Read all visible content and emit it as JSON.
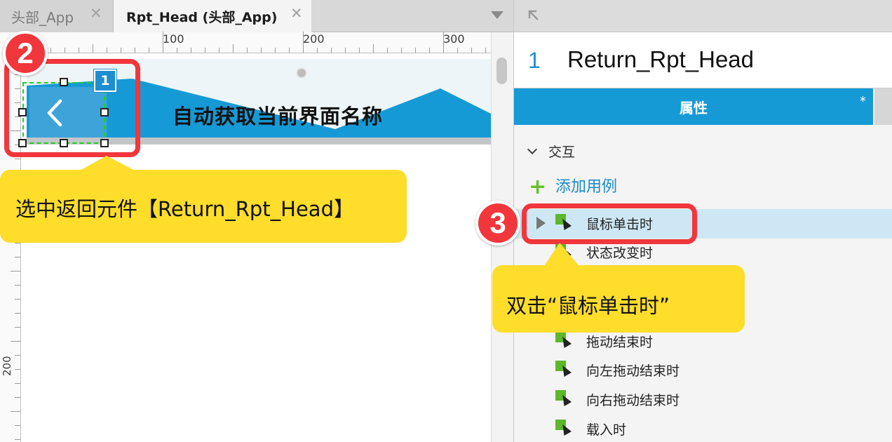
{
  "tabs": [
    {
      "label": "头部_App",
      "close": "✕",
      "active": false
    },
    {
      "label": "Rpt_Head (头部_App)",
      "close": "✕",
      "active": true
    }
  ],
  "ruler": {
    "h_labels": [
      "100",
      "200",
      "300"
    ],
    "v_label": "200"
  },
  "canvas": {
    "header_title": "自动获取当前界面名称",
    "selection_number": "1"
  },
  "panel": {
    "widget_number": "1",
    "widget_name": "Return_Rpt_Head",
    "tab_label": "属性",
    "tab_star": "*",
    "section_label": "交互",
    "add_case_label": "添加用例",
    "events": [
      "鼠标单击时",
      "状态改变时",
      "拖动结束时",
      "向左拖动结束时",
      "向右拖动结束时",
      "载入时"
    ]
  },
  "callouts": [
    {
      "badge": "2",
      "text": "选中返回元件【Return_Rpt_Head】"
    },
    {
      "badge": "3",
      "text": "双击“鼠标单击时”"
    }
  ],
  "colors": {
    "accent_blue": "#169ad6",
    "callout_red": "#f1363c",
    "callout_yellow": "#fedd2b",
    "event_green": "#5cb82a",
    "selection_green": "#22cc22"
  }
}
